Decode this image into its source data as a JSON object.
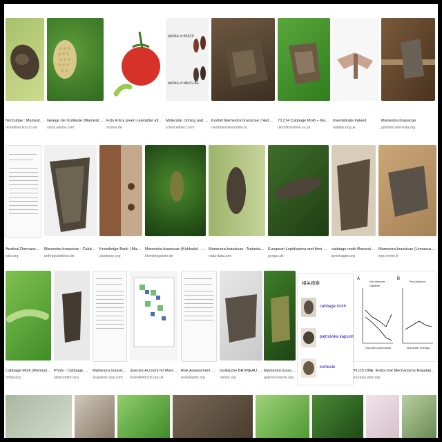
{
  "results": [
    {
      "caption": "Noctuidae : Mamestra b...",
      "domain": "mothidsection.co.uk"
    },
    {
      "caption": "Gelege der Kohleule (Mamestra brassicae ...",
      "domain": "stock.adobe.com"
    },
    {
      "caption": "Foto A tiny green caterpillar attempting t...",
      "domain": "zoonar.de"
    },
    {
      "caption": "Molecular cloning and RNA int...",
      "domain": "sciencedirect.com"
    },
    {
      "caption": "Koolull Mamestra brassicae | Nederlands Soo...",
      "domain": "nederlandsesoorten.nl"
    },
    {
      "caption": "73.274 Cabbage Moth – Mamestra ...",
      "domain": "ukmothsonline.co.uk"
    },
    {
      "caption": "Invertebrate Ireland",
      "domain": "habitas.org.uk"
    },
    {
      "caption": "Mamestra brassicae",
      "domain": "gdsmmi.altervista.org"
    },
    {
      "caption": "Aestival Dormancy in t...",
      "domain": "jstor.org"
    },
    {
      "caption": "Mamestra brassicae - Cabbage Moth ...",
      "domain": "arthropodafotos.de"
    },
    {
      "caption": "Knowledge Bank | Mamestra...",
      "domain": "plantwise.org"
    },
    {
      "caption": "Mamestra brassicae (Kohleule) - Kleintierga...",
      "domain": "kleintiergalerie.de"
    },
    {
      "caption": "Mamestra brassicae - Naturdata - Biodiv...",
      "domain": "naturdata.com"
    },
    {
      "caption": "European Lepidoptera and their ecology: Ma...",
      "domain": "pyrgus.de"
    },
    {
      "caption": "cabbage moth Mamestra bra...",
      "domain": "ipmimages.org"
    },
    {
      "caption": "Mamestra brassicae (Linnaeus, 1758) - Bra...",
      "domain": "inpn.mnhn.fr"
    },
    {
      "caption": "Cabbage Moth (Mamestra bra...",
      "domain": "hmbg.org"
    },
    {
      "caption": "Photo - Cabbage Moth ...",
      "domain": "observation.org"
    },
    {
      "caption": "Mamestra brassicae N...",
      "domain": "academic.oup.com"
    },
    {
      "caption": "Species Account for Mamestra br...",
      "domain": "essexfieldclub.org.uk"
    },
    {
      "caption": "Risk Assessment Studi...",
      "domain": "europepmc.org"
    },
    {
      "caption": "Guillaume BRUNEAU - Photo...",
      "domain": "orenia.org"
    },
    {
      "caption": "Mamestra brassicae - w...",
      "domain": "galerie-insecte.org"
    },
    {
      "caption": "PLOS ONE: Endocrine Mechanisms Regulating Post-Diapause ...",
      "domain": "journals.plos.org"
    }
  ],
  "related": {
    "title": "相关搜索",
    "items": [
      "cabbage moth",
      "piętnówka kapustnica",
      "kohleule"
    ]
  },
  "chart": {
    "left_legend": [
      "Non-diapause",
      "Diapause"
    ],
    "right_title": "Post-diapause",
    "left_xlabel": "Days after pupal ecdysis",
    "right_xlabel": "Weeks after emerging",
    "panel_labels": [
      "A",
      "B"
    ]
  },
  "doc_text": {
    "molecular_top": "dsRNA of B55ZP",
    "molecular_bottom": "dsRNA of MbVG-BE"
  },
  "colors": {
    "background": "#000000",
    "page": "#ffffff",
    "caption": "#222222",
    "domain": "#666666",
    "link": "#1a0dab"
  }
}
